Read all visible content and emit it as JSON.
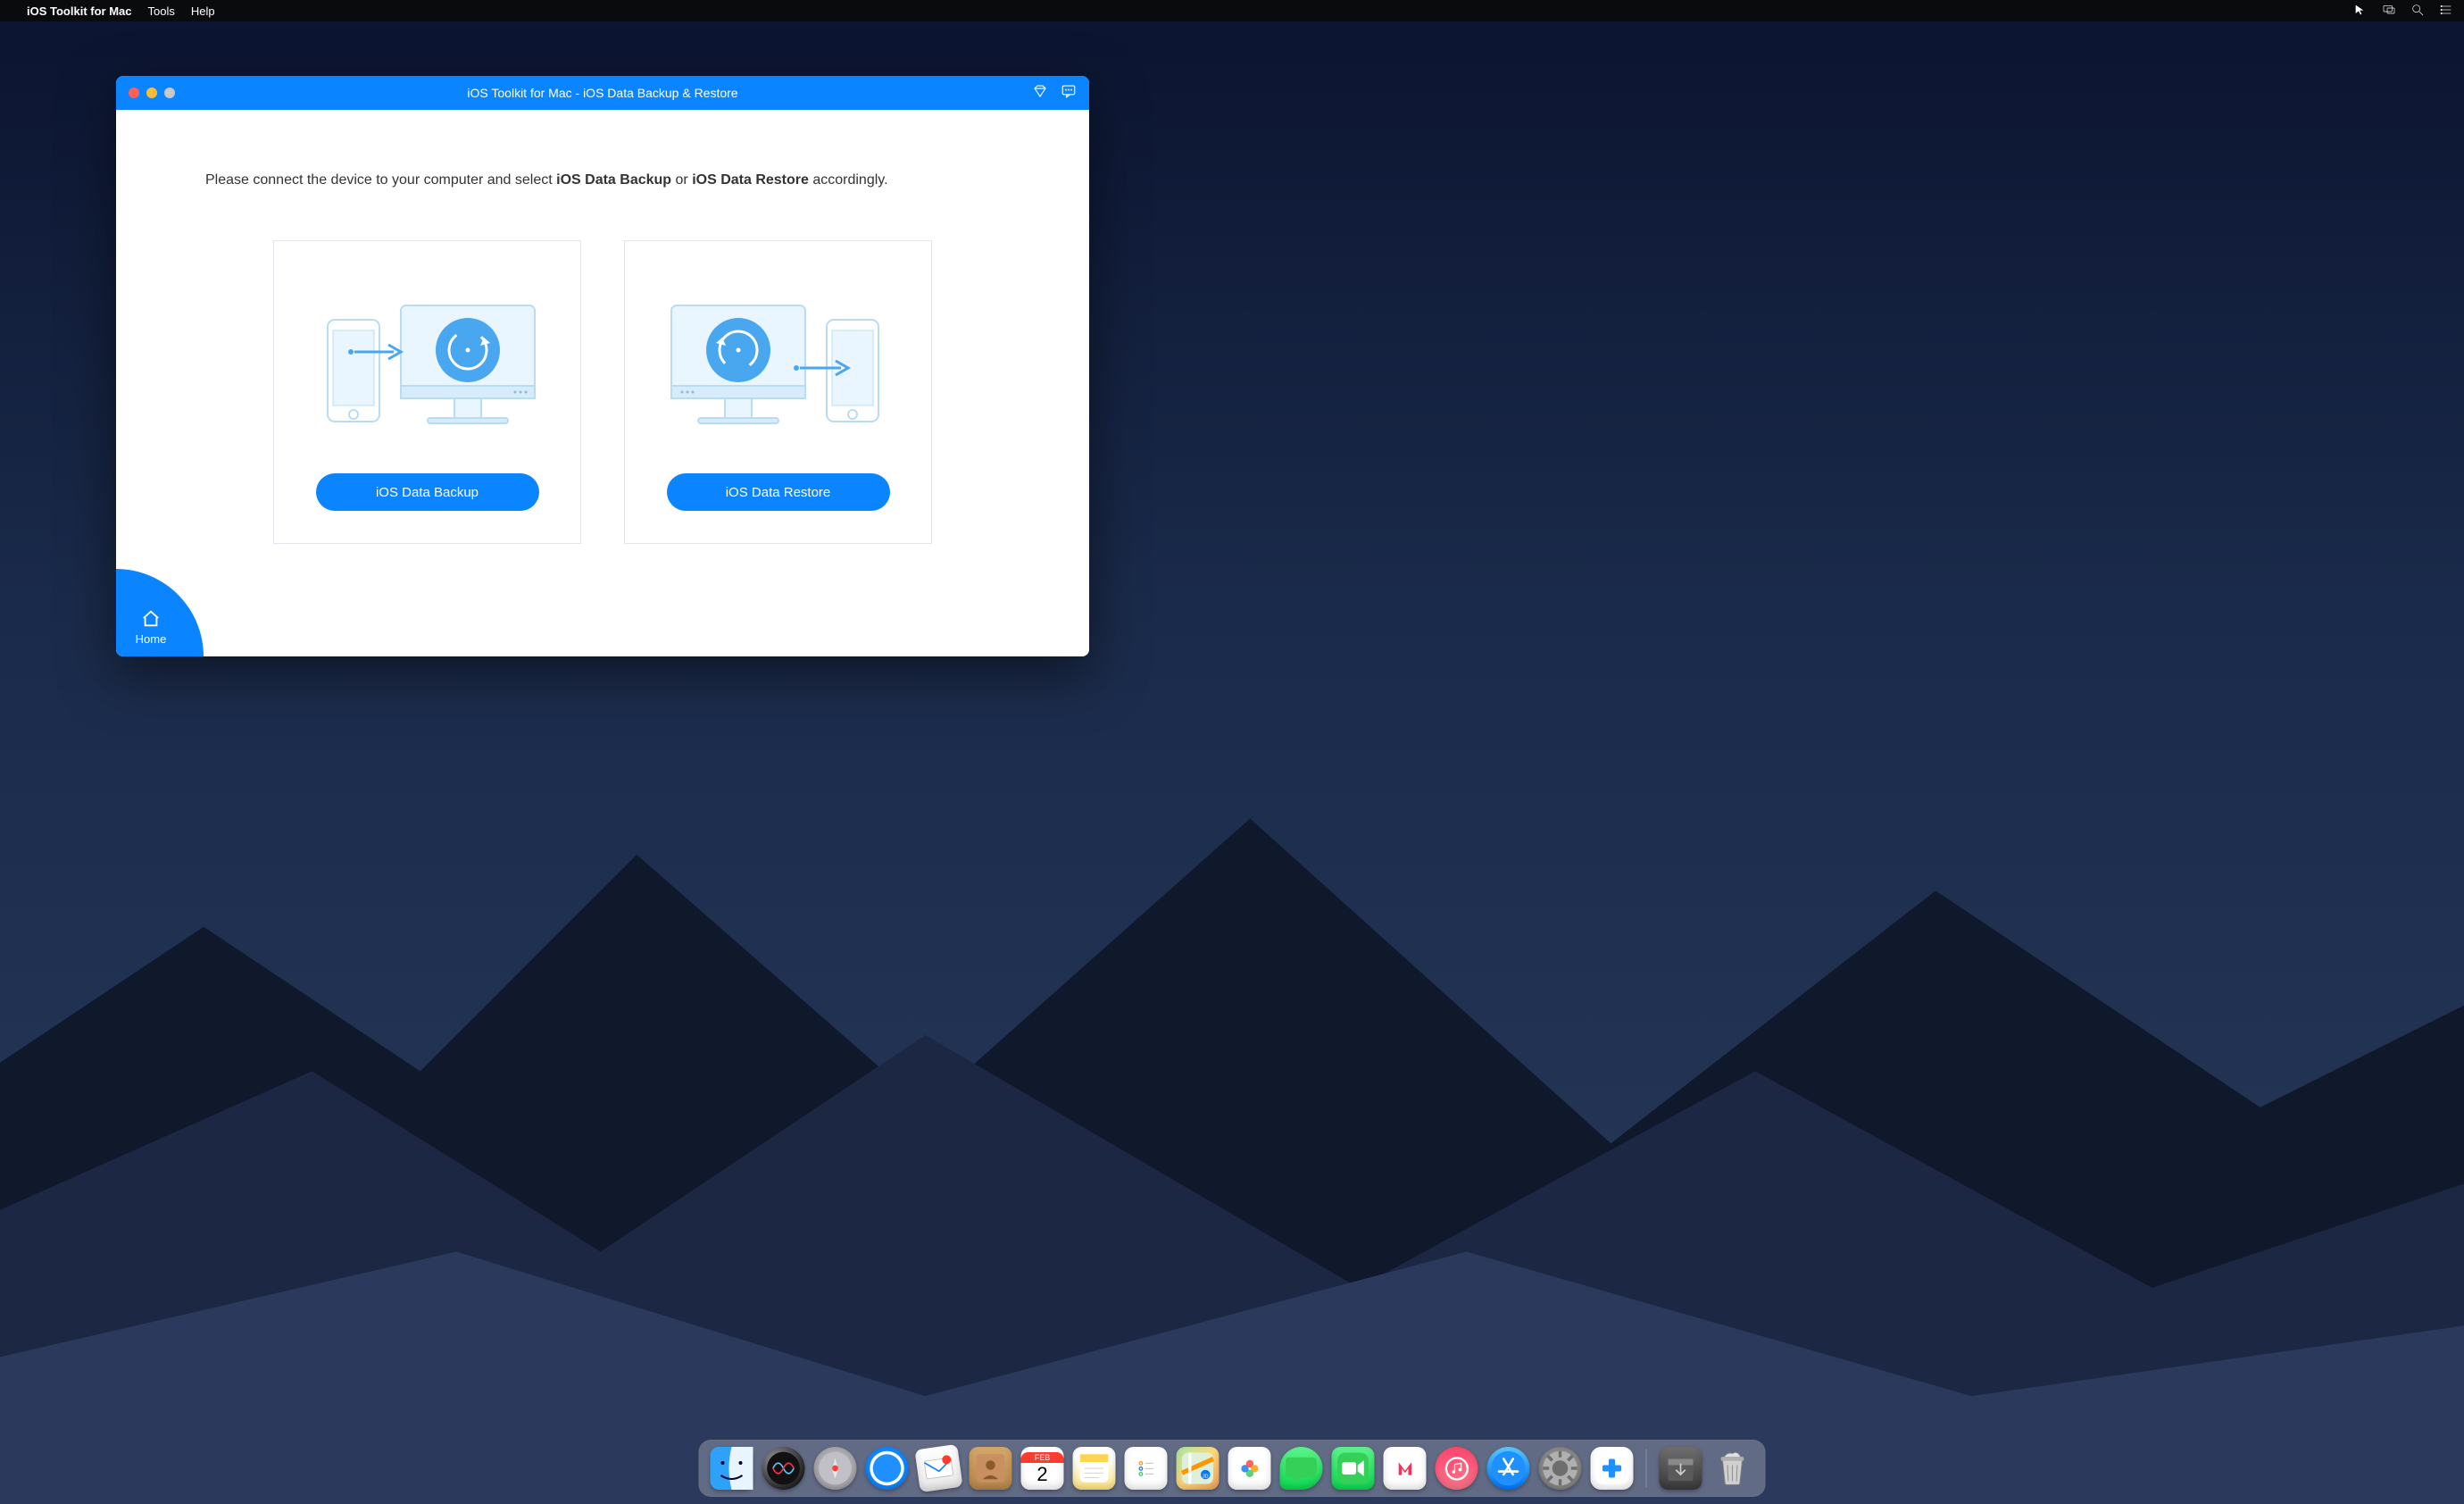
{
  "menubar": {
    "app_name": "iOS Toolkit for Mac",
    "items": [
      "Tools",
      "Help"
    ]
  },
  "window": {
    "title": "iOS Toolkit for Mac - iOS Data Backup & Restore"
  },
  "instruction": {
    "pre": "Please connect the device to your computer and select ",
    "b1": "iOS Data Backup",
    "mid": " or ",
    "b2": "iOS Data Restore",
    "post": " accordingly."
  },
  "cards": {
    "backup_label": "iOS Data Backup",
    "restore_label": "iOS Data Restore"
  },
  "home_label": "Home",
  "calendar": {
    "month": "FEB",
    "day": "2"
  },
  "dock": {
    "items": [
      {
        "name": "finder-icon"
      },
      {
        "name": "siri-icon"
      },
      {
        "name": "launchpad-icon"
      },
      {
        "name": "safari-icon"
      },
      {
        "name": "mail-icon"
      },
      {
        "name": "contacts-icon"
      },
      {
        "name": "calendar-icon"
      },
      {
        "name": "notes-icon"
      },
      {
        "name": "reminders-icon"
      },
      {
        "name": "maps-icon"
      },
      {
        "name": "photos-icon"
      },
      {
        "name": "messages-icon"
      },
      {
        "name": "facetime-icon"
      },
      {
        "name": "news-icon"
      },
      {
        "name": "music-icon"
      },
      {
        "name": "appstore-icon"
      },
      {
        "name": "prefs-icon"
      },
      {
        "name": "toolkit-icon"
      },
      {
        "name": "downloads-icon"
      },
      {
        "name": "trash-icon"
      }
    ]
  }
}
